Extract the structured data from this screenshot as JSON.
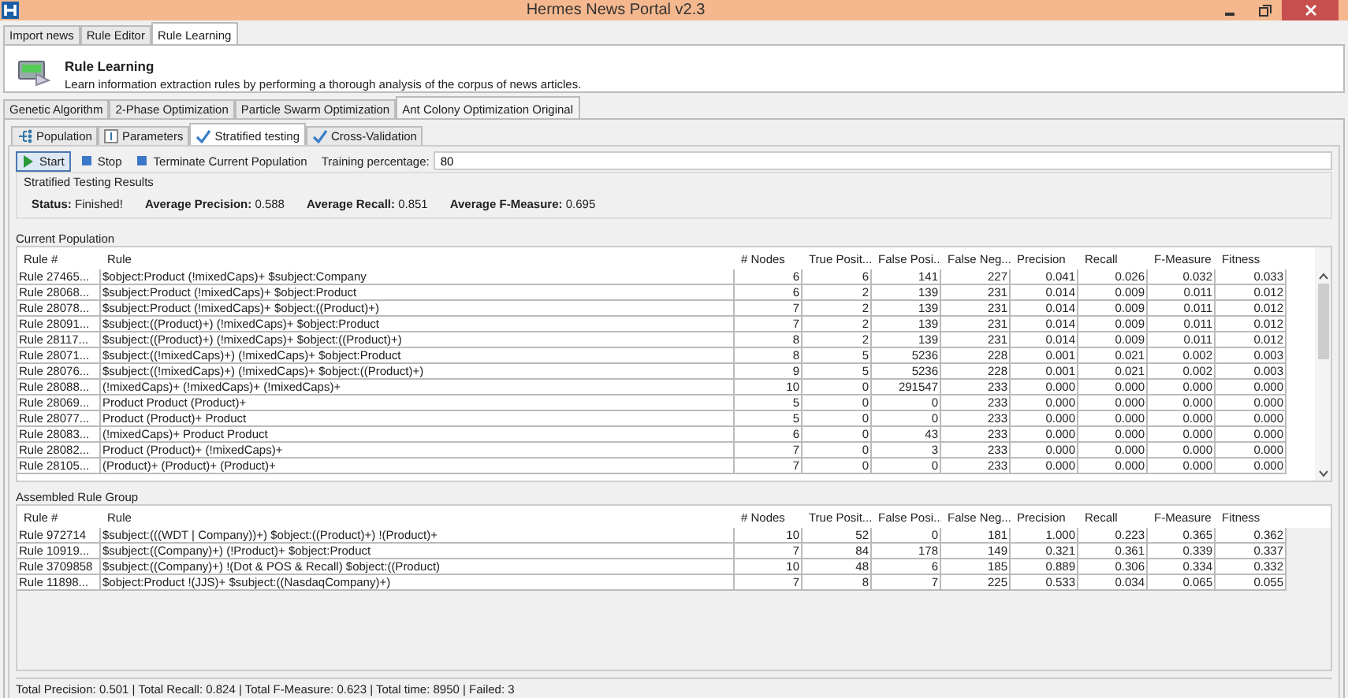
{
  "window": {
    "title": "Hermes News Portal v2.3"
  },
  "main_tabs": [
    {
      "label": "Import news",
      "selected": false
    },
    {
      "label": "Rule Editor",
      "selected": false
    },
    {
      "label": "Rule Learning",
      "selected": true
    }
  ],
  "header": {
    "title": "Rule Learning",
    "description": "Learn information extraction rules by performing a thorough analysis of the corpus of news articles."
  },
  "algorithm_tabs": [
    {
      "label": "Genetic Algorithm",
      "selected": false
    },
    {
      "label": "2-Phase Optimization",
      "selected": false
    },
    {
      "label": "Particle Swarm Optimization",
      "selected": false
    },
    {
      "label": "Ant Colony Optimization Original",
      "selected": true
    }
  ],
  "sub_tabs": [
    {
      "label": "Population",
      "kind": "tree",
      "selected": false
    },
    {
      "label": "Parameters",
      "kind": "params",
      "selected": false
    },
    {
      "label": "Stratified testing",
      "kind": "check",
      "selected": true
    },
    {
      "label": "Cross-Validation",
      "kind": "check",
      "selected": false
    }
  ],
  "toolbar": {
    "buttons": [
      {
        "label": "Start",
        "kind": "play"
      },
      {
        "label": "Stop",
        "kind": "square"
      },
      {
        "label": "Terminate Current Population",
        "kind": "square"
      }
    ],
    "training_label": "Training percentage:",
    "training_value": "80"
  },
  "results": {
    "title": "Stratified Testing Results",
    "stats": [
      {
        "label": "Status:",
        "value": "Finished!"
      },
      {
        "label": "Average Precision:",
        "value": "0.588"
      },
      {
        "label": "Average Recall:",
        "value": "0.851"
      },
      {
        "label": "Average F-Measure:",
        "value": "0.695"
      }
    ]
  },
  "population": {
    "title": "Current Population",
    "columns": [
      "Rule #",
      "Rule",
      "# Nodes",
      "True Posit...",
      "False Posi...",
      "False Neg...",
      "Precision",
      "Recall",
      "F-Measure",
      "Fitness"
    ],
    "rows": [
      [
        "Rule 27465...",
        "$object:Product (!mixedCaps)+ $subject:Company",
        "6",
        "6",
        "141",
        "227",
        "0.041",
        "0.026",
        "0.032",
        "0.033"
      ],
      [
        "Rule 28068...",
        "$subject:Product (!mixedCaps)+ $object:Product",
        "6",
        "2",
        "139",
        "231",
        "0.014",
        "0.009",
        "0.011",
        "0.012"
      ],
      [
        "Rule 28078...",
        "$subject:Product (!mixedCaps)+ $object:((Product)+)",
        "7",
        "2",
        "139",
        "231",
        "0.014",
        "0.009",
        "0.011",
        "0.012"
      ],
      [
        "Rule 28091...",
        "$subject:((Product)+) (!mixedCaps)+ $object:Product",
        "7",
        "2",
        "139",
        "231",
        "0.014",
        "0.009",
        "0.011",
        "0.012"
      ],
      [
        "Rule 28117...",
        "$subject:((Product)+) (!mixedCaps)+ $object:((Product)+)",
        "8",
        "2",
        "139",
        "231",
        "0.014",
        "0.009",
        "0.011",
        "0.012"
      ],
      [
        "Rule 28071...",
        "$subject:((!mixedCaps)+) (!mixedCaps)+ $object:Product",
        "8",
        "5",
        "5236",
        "228",
        "0.001",
        "0.021",
        "0.002",
        "0.003"
      ],
      [
        "Rule 28076...",
        "$subject:((!mixedCaps)+) (!mixedCaps)+ $object:((Product)+)",
        "9",
        "5",
        "5236",
        "228",
        "0.001",
        "0.021",
        "0.002",
        "0.003"
      ],
      [
        "Rule 28088...",
        "(!mixedCaps)+ (!mixedCaps)+ (!mixedCaps)+",
        "10",
        "0",
        "291547",
        "233",
        "0.000",
        "0.000",
        "0.000",
        "0.000"
      ],
      [
        "Rule 28069...",
        "Product Product (Product)+",
        "5",
        "0",
        "0",
        "233",
        "0.000",
        "0.000",
        "0.000",
        "0.000"
      ],
      [
        "Rule 28077...",
        "Product (Product)+ Product",
        "5",
        "0",
        "0",
        "233",
        "0.000",
        "0.000",
        "0.000",
        "0.000"
      ],
      [
        "Rule 28083...",
        "(!mixedCaps)+ Product Product",
        "6",
        "0",
        "43",
        "233",
        "0.000",
        "0.000",
        "0.000",
        "0.000"
      ],
      [
        "Rule 28082...",
        "Product (Product)+ (!mixedCaps)+",
        "7",
        "0",
        "3",
        "233",
        "0.000",
        "0.000",
        "0.000",
        "0.000"
      ],
      [
        "Rule 28105...",
        "(Product)+ (Product)+ (Product)+",
        "7",
        "0",
        "0",
        "233",
        "0.000",
        "0.000",
        "0.000",
        "0.000"
      ]
    ]
  },
  "assembled": {
    "title": "Assembled Rule Group",
    "columns": [
      "Rule #",
      "Rule",
      "# Nodes",
      "True Posit...",
      "False Posi...",
      "False Neg...",
      "Precision",
      "Recall",
      "F-Measure",
      "Fitness"
    ],
    "rows": [
      [
        "Rule 972714",
        "$subject:(((WDT | Company))+) $object:((Product)+) !(Product)+",
        "10",
        "52",
        "0",
        "181",
        "1.000",
        "0.223",
        "0.365",
        "0.362"
      ],
      [
        "Rule 10919...",
        "$subject:((Company)+) (!Product)+ $object:Product",
        "7",
        "84",
        "178",
        "149",
        "0.321",
        "0.361",
        "0.339",
        "0.337"
      ],
      [
        "Rule 3709858",
        "$subject:((Company)+) !(Dot & POS & Recall) $object:((Product)",
        "10",
        "48",
        "6",
        "185",
        "0.889",
        "0.306",
        "0.334",
        "0.332"
      ],
      [
        "Rule 11898...",
        "$object:Product !(JJS)+ $subject:((NasdaqCompany)+)",
        "7",
        "8",
        "7",
        "225",
        "0.533",
        "0.034",
        "0.065",
        "0.055"
      ]
    ]
  },
  "status_bar": "Total Precision: 0.501 | Total Recall: 0.824 | Total F-Measure: 0.623 | Total time: 8950 | Failed: 3"
}
